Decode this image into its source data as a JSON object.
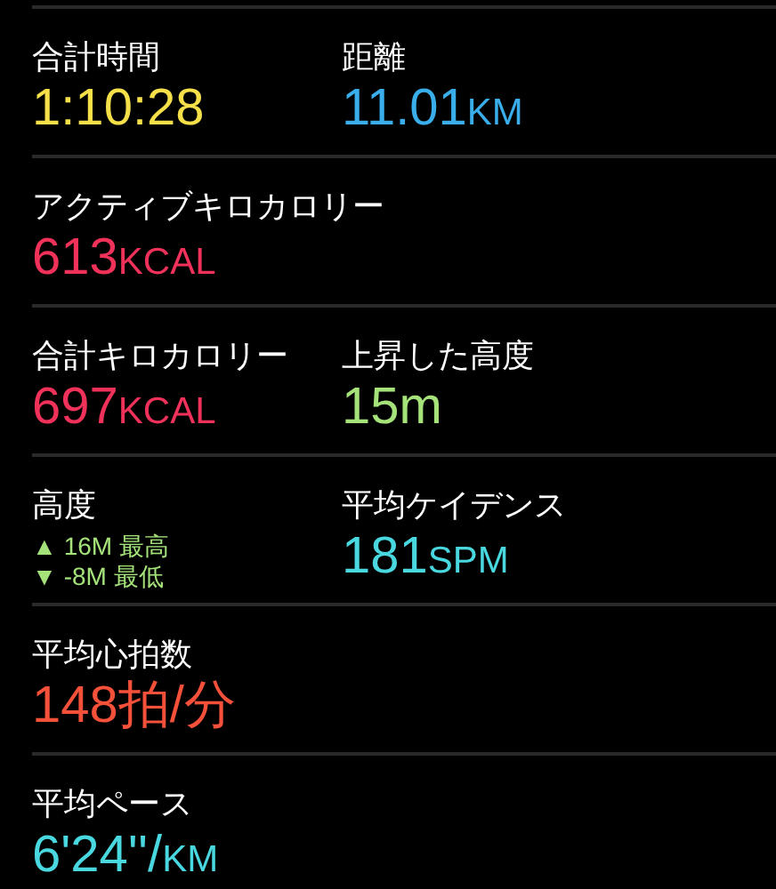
{
  "rows": [
    {
      "metrics": [
        {
          "kind": "value",
          "label": "合計時間",
          "value": "1:10:28",
          "color": "#f5e04a"
        },
        {
          "kind": "value",
          "label": "距離",
          "value": "11.01",
          "unit": "KM",
          "color": "#3aaeea"
        }
      ]
    },
    {
      "metrics": [
        {
          "kind": "value",
          "label": "アクティブキロカロリー",
          "value": "613",
          "unit": "KCAL",
          "color": "#f0325a"
        }
      ]
    },
    {
      "metrics": [
        {
          "kind": "value",
          "label": "合計キロカロリー",
          "value": "697",
          "unit": "KCAL",
          "color": "#f0325a"
        },
        {
          "kind": "value",
          "label": "上昇した高度",
          "value": "15m",
          "color": "#a5e37a"
        }
      ]
    },
    {
      "metrics": [
        {
          "kind": "range",
          "label": "高度",
          "color": "#a5e37a",
          "items": [
            {
              "arrow": "▲",
              "altitude": "16M",
              "extreme": "最高"
            },
            {
              "arrow": "▼",
              "altitude": "-8M",
              "extreme": "最低"
            }
          ]
        },
        {
          "kind": "value",
          "label": "平均ケイデンス",
          "value": "181",
          "unit": "SPM",
          "color": "#4ad8e0"
        }
      ]
    },
    {
      "metrics": [
        {
          "kind": "value",
          "label": "平均心拍数",
          "value": "148拍/分",
          "color": "#f5503a"
        }
      ]
    },
    {
      "metrics": [
        {
          "kind": "value",
          "label": "平均ペース",
          "value": "6'24''/",
          "unit": "KM",
          "color": "#4ad8e0"
        }
      ]
    }
  ]
}
